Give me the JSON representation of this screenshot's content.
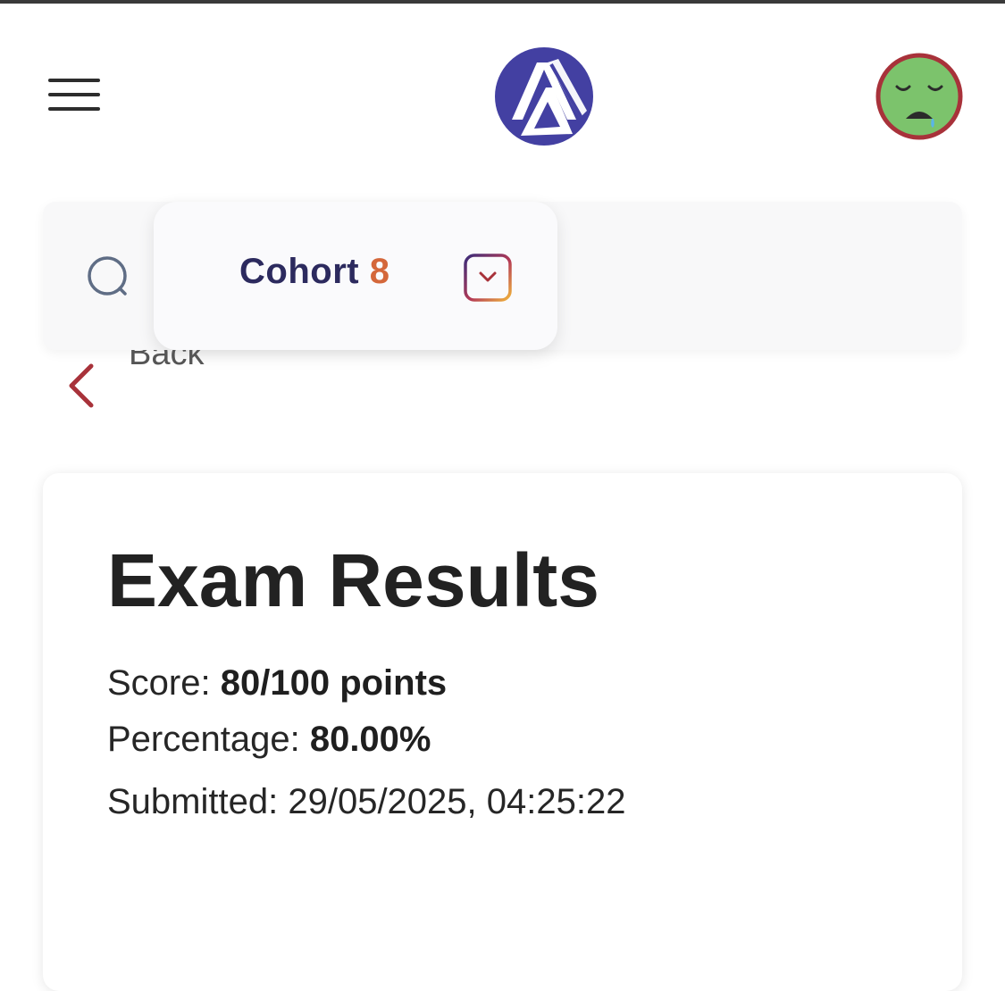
{
  "header": {
    "menu_icon": "hamburger-menu-icon",
    "logo_icon": "brand-logo-a",
    "avatar_icon": "sad-face-avatar",
    "colors": {
      "logo_bg": "#4340a2",
      "avatar_fill": "#7cc36c",
      "avatar_ring": "#a8323a"
    }
  },
  "toolbar": {
    "search_icon": "search-icon",
    "cohort": {
      "word": "Cohort",
      "number": "8"
    },
    "dropdown_icon": "chevron-down-icon",
    "colors": {
      "cohort_word": "#2c2a5e",
      "cohort_number": "#d4673a"
    }
  },
  "back": {
    "label": "Back",
    "icon": "chevron-left-icon",
    "color": "#a8323a"
  },
  "results": {
    "title": "Exam Results",
    "score_label": "Score:",
    "score_value": "80/100 points",
    "percentage_label": "Percentage:",
    "percentage_value": "80.00%",
    "submitted_label": "Submitted:",
    "submitted_value": "29/05/2025, 04:25:22"
  }
}
